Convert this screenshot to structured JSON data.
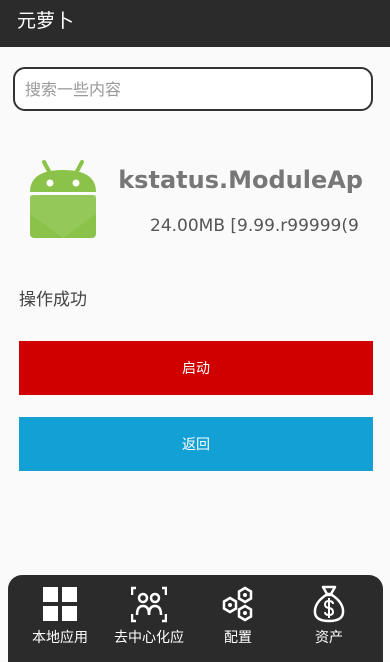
{
  "app": {
    "title": "元萝卜"
  },
  "search": {
    "placeholder": "搜索一些内容",
    "value": ""
  },
  "package": {
    "name": "kstatus.ModuleAp",
    "meta": "24.00MB [9.99.r99999(9"
  },
  "status_text": "操作成功",
  "buttons": {
    "launch": "启动",
    "back": "返回"
  },
  "colors": {
    "topbar": "#2b2b2b",
    "launch": "#d10000",
    "back": "#13a0d4",
    "android_green": "#8bc34a"
  },
  "tabs": [
    {
      "label": "本地应用",
      "icon": "grid-icon"
    },
    {
      "label": "去中心化应",
      "icon": "people-icon"
    },
    {
      "label": "配置",
      "icon": "hexagon-config-icon"
    },
    {
      "label": "资产",
      "icon": "money-bag-icon"
    }
  ]
}
